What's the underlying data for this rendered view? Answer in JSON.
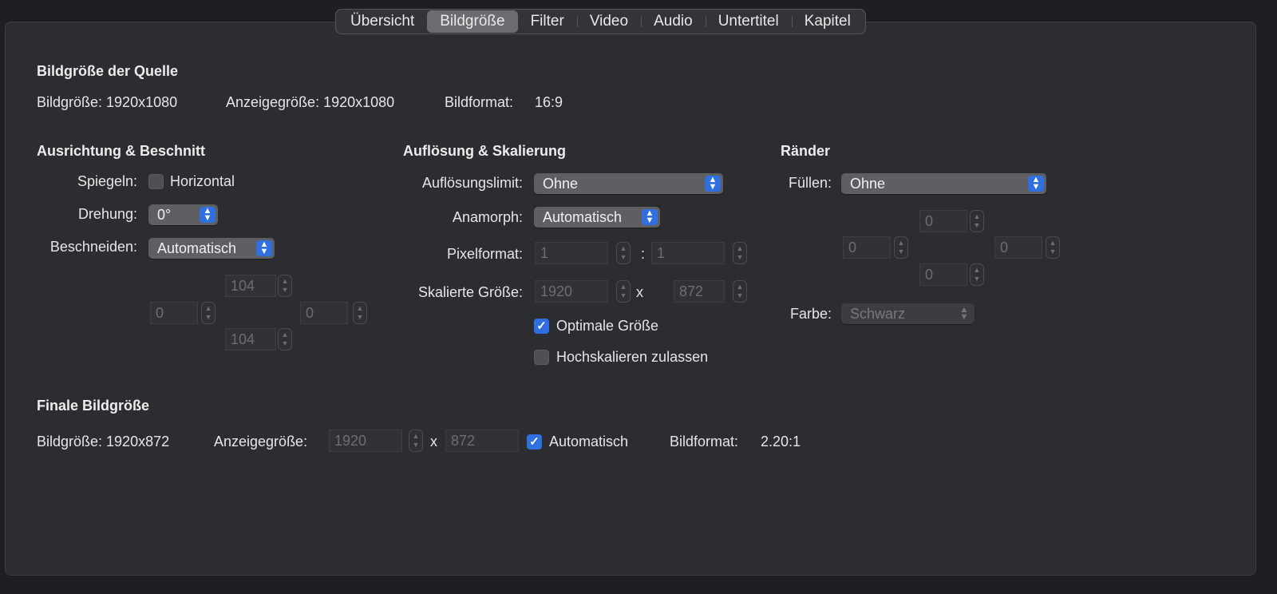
{
  "tabs": [
    "Übersicht",
    "Bildgröße",
    "Filter",
    "Video",
    "Audio",
    "Untertitel",
    "Kapitel"
  ],
  "source": {
    "heading": "Bildgröße der Quelle",
    "size_label": "Bildgröße: 1920x1080",
    "display_label": "Anzeigegröße: 1920x1080",
    "format_label": "Bildformat:",
    "format_value": "16:9"
  },
  "orientation": {
    "heading": "Ausrichtung & Beschnitt",
    "flip_label": "Spiegeln:",
    "flip_horizontal_label": "Horizontal",
    "flip_horizontal_checked": false,
    "rotation_label": "Drehung:",
    "rotation_value": "0°",
    "crop_label": "Beschneiden:",
    "crop_value": "Automatisch",
    "crop_top": "104",
    "crop_left": "0",
    "crop_right": "0",
    "crop_bottom": "104"
  },
  "resolution": {
    "heading": "Auflösung & Skalierung",
    "limit_label": "Auflösungslimit:",
    "limit_value": "Ohne",
    "anamorphic_label": "Anamorph:",
    "anamorphic_value": "Automatisch",
    "pixel_format_label": "Pixelformat:",
    "pixel_format_a": "1",
    "pixel_format_sep": ":",
    "pixel_format_b": "1",
    "scaled_label": "Skalierte Größe:",
    "scaled_w": "1920",
    "scaled_sep": "x",
    "scaled_h": "872",
    "optimal_label": "Optimale Größe",
    "optimal_checked": true,
    "upscale_label": "Hochskalieren zulassen",
    "upscale_checked": false
  },
  "borders": {
    "heading": "Ränder",
    "fill_label": "Füllen:",
    "fill_value": "Ohne",
    "top": "0",
    "left": "0",
    "right": "0",
    "bottom": "0",
    "color_label": "Farbe:",
    "color_value": "Schwarz"
  },
  "final": {
    "heading": "Finale Bildgröße",
    "size_label": "Bildgröße: 1920x872",
    "display_label": "Anzeigegröße:",
    "display_w": "1920",
    "display_sep": "x",
    "display_h": "872",
    "auto_label": "Automatisch",
    "auto_checked": true,
    "format_label": "Bildformat:",
    "format_value": "2.20:1"
  }
}
